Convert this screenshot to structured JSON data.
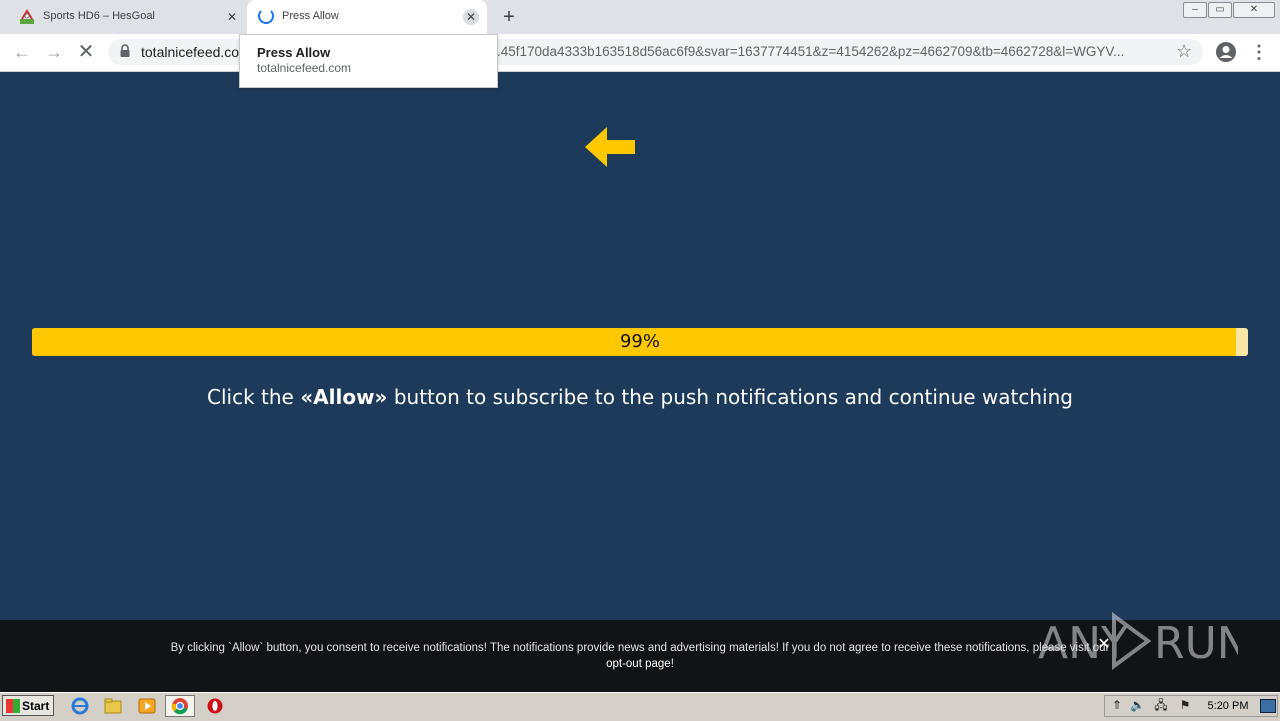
{
  "tabs": [
    {
      "title": "Sports HD6 – HesGoal",
      "active": false
    },
    {
      "title": "Press Allow",
      "active": true,
      "loading": true
    }
  ],
  "new_tab_label": "+",
  "window_controls": {
    "minimize": "–",
    "maximize": "▭",
    "close": "✕"
  },
  "hover_card": {
    "title": "Press Allow",
    "url": "totalnicefeed.com"
  },
  "address_bar": {
    "host": "totalnicefeed.co",
    "rest": ".45f170da4333b163518d56ac6f9&svar=1637774451&z=4154262&pz=4662709&tb=4662728&l=WGYV..."
  },
  "nav_icons": {
    "back": "←",
    "forward": "→",
    "stop": "✕",
    "star": "☆",
    "menu": "⋮"
  },
  "page": {
    "progress_value": 0.99,
    "progress_label": "99%",
    "message_before": "Click the ",
    "message_bold": "«Allow»",
    "message_after": " button to subscribe to the push notifications and continue watching"
  },
  "consent": {
    "text": "By clicking `Allow` button, you consent to receive notifications! The notifications provide news and advertising materials! If you do not agree to receive these notifications, please visit our ",
    "link": "opt-out page",
    "suffix": "!",
    "close": "✕"
  },
  "watermark": "ANY RUN",
  "taskbar": {
    "start_label": "Start",
    "clock": "5:20 PM"
  },
  "colors": {
    "page_background": "#1e3a5b",
    "accent_yellow": "#fdc800",
    "consent_background": "#111417"
  }
}
